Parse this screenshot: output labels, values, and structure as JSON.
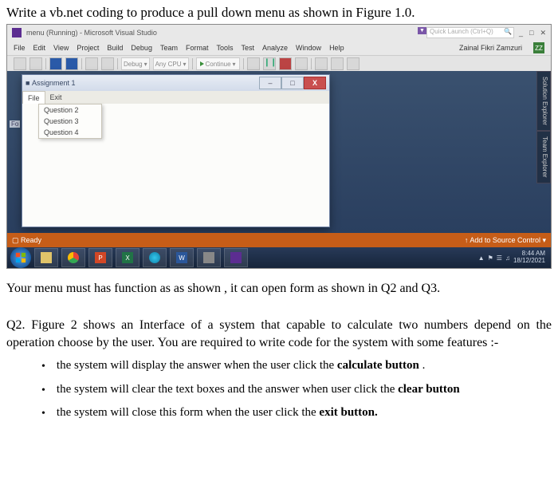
{
  "q_title": "Write a vb.net coding to produce a pull down menu as shown in Figure 1.0.",
  "vs": {
    "title": "menu (Running) - Microsoft Visual Studio",
    "quick_launch_placeholder": "Quick Launch (Ctrl+Q)",
    "user": "Zainal Fikri Zamzuri",
    "user_badge": "ZZ",
    "menu": [
      "File",
      "Edit",
      "View",
      "Project",
      "Build",
      "Debug",
      "Team",
      "Format",
      "Tools",
      "Test",
      "Analyze",
      "Window",
      "Help"
    ],
    "config_label": "Debug",
    "platform_label": "Any CPU",
    "continue_label": "Continue",
    "side_tabs": [
      "Solution Explorer",
      "Team Explorer"
    ],
    "form_label": "Fo",
    "status_ready": "Ready",
    "status_source": "Add to Source Control"
  },
  "form_window": {
    "title": "Assignment 1",
    "menu_items": [
      "File",
      "Exit"
    ],
    "dropdown_items": [
      "Question 2",
      "Question 3",
      "Question 4"
    ],
    "close_x": "X"
  },
  "taskbar": {
    "tray_icons": [
      "▲",
      "⚑",
      "☰",
      "♫",
      "■"
    ],
    "time": "8:44 AM",
    "date": "18/12/2021"
  },
  "instr_line": "Your menu must has function as as shown , it can open form as shown in Q2 and Q3.",
  "q2": {
    "para": "Q2. Figure 2 shows an Interface  of a system that capable to calculate two numbers depend on the operation choose by the user. You are required to write code for the system with some features :-",
    "f1_a": "the system will display the answer when the user click the ",
    "f1_b": "calculate button",
    "f1_c": " .",
    "f2_a": "the system will clear the text boxes and the answer when user click the ",
    "f2_b": "clear button",
    "f3_a": "the system will close this form when the user click the ",
    "f3_b": "exit button."
  }
}
